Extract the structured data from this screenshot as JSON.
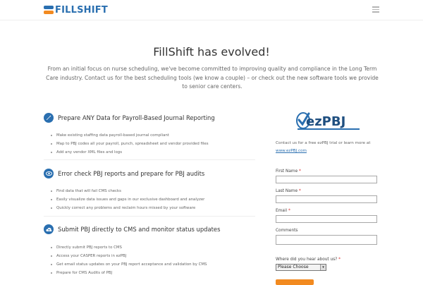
{
  "header": {
    "brand": "FILLSHIFT",
    "menu_icon": "hamburger-icon"
  },
  "hero": {
    "headline": "FillShift has evolved!",
    "intro": "From an initial focus on nurse scheduling, we've become committed to improving quality and compliance in the Long Term Care industry.  Contact us for the best scheduling tools (we know a couple) – or check out the new software tools we provide to senior care centers."
  },
  "sections": [
    {
      "icon": "pencil-icon",
      "title": "Prepare ANY Data for Payroll-Based Journal Reporting",
      "bullets": [
        "Make existing staffing data payroll-based journal compliant",
        "Map to PBJ codes all your payroll, punch, spreadsheet and vendor provided files",
        "Add any vendor XML files and logs"
      ]
    },
    {
      "icon": "eye-icon",
      "title": "Error check PBJ reports and prepare for PBJ audits",
      "bullets": [
        "Find data that will fail CMS checks",
        "Easily visualize data issues and gaps in our exclusive dashboard and analyzer",
        "Quickly correct any problems and reclaim hours missed by your software"
      ]
    },
    {
      "icon": "cloud-upload-icon",
      "title": "Submit PBJ directly to CMS and monitor status updates",
      "bullets": [
        "Directly submit PBJ reports to CMS",
        "Access your CASPER reports in ezPBJ",
        "Get email status updates on your PBJ report acceptance and validation by CMS",
        "Prepare for CMS Audits of PBJ"
      ]
    }
  ],
  "sidebar": {
    "logo_text": "ezPBJ",
    "contact_text": "Contact us for a free ezPBJ trial or learn more at",
    "link_text": "www.ezPBJ.com"
  },
  "form": {
    "first_name_label": "First Name",
    "last_name_label": "Last Name",
    "email_label": "Email",
    "comments_label": "Comments",
    "hear_label": "Where did you hear about us?",
    "required_mark": "*",
    "select_value": "Please Choose"
  },
  "colors": {
    "brand_blue": "#2a6fb0",
    "brand_orange": "#f28a20"
  }
}
